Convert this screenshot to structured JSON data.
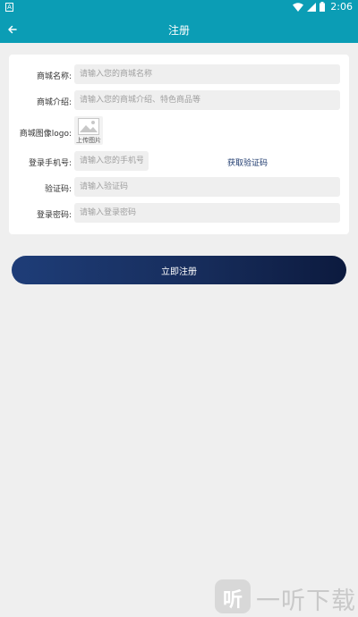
{
  "status_bar": {
    "time": "2:06"
  },
  "app_bar": {
    "title": "注册"
  },
  "form": {
    "shop_name": {
      "label": "商城名称:",
      "placeholder": "请输入您的商城名称"
    },
    "shop_intro": {
      "label": "商城介绍:",
      "placeholder": "请输入您的商城介绍、特色商品等"
    },
    "shop_image": {
      "label": "商城图像logo:",
      "upload_text": "上传图片"
    },
    "phone": {
      "label": "登录手机号:",
      "placeholder": "请输入您的手机号",
      "sms_link": "获取验证码"
    },
    "code": {
      "label": "验证码:",
      "placeholder": "请输入验证码"
    },
    "password": {
      "label": "登录密码:",
      "placeholder": "请输入登录密码"
    }
  },
  "register_button": "立即注册",
  "watermark": {
    "logo_char": "听",
    "text": "一听下载"
  }
}
